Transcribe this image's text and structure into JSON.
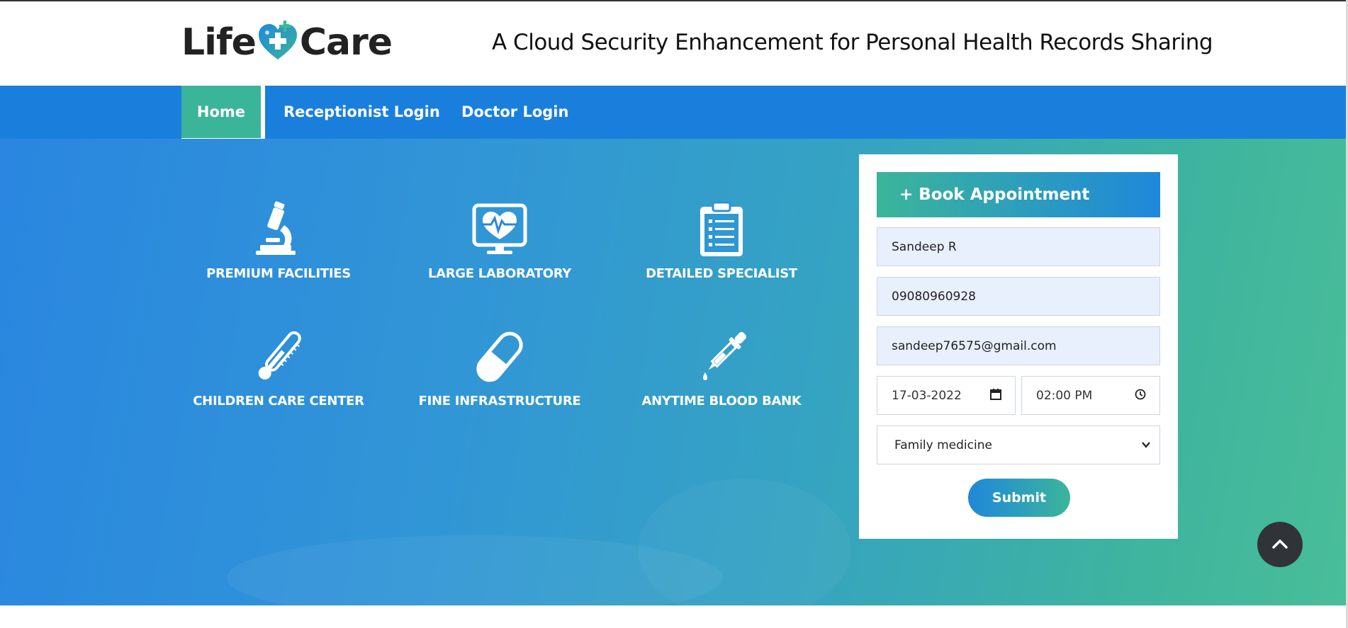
{
  "header": {
    "logo_part1": "Life",
    "logo_part2": "Care",
    "tagline": "A Cloud Security Enhancement for Personal Health Records Sharing"
  },
  "nav": {
    "items": [
      {
        "label": "Home",
        "active": true
      },
      {
        "label": "Receptionist Login"
      },
      {
        "label": "Doctor Login"
      }
    ]
  },
  "features": [
    {
      "label": "PREMIUM FACILITIES",
      "icon": "microscope-icon"
    },
    {
      "label": "LARGE LABORATORY",
      "icon": "heart-monitor-icon"
    },
    {
      "label": "DETAILED SPECIALIST",
      "icon": "clipboard-icon"
    },
    {
      "label": "CHILDREN CARE CENTER",
      "icon": "thermometer-icon"
    },
    {
      "label": "FINE INFRASTRUCTURE",
      "icon": "pill-icon"
    },
    {
      "label": "ANYTIME BLOOD BANK",
      "icon": "dropper-icon"
    }
  ],
  "form": {
    "title": "+ Book Appointment",
    "name": "Sandeep R",
    "phone": "09080960928",
    "email": "sandeep76575@gmail.com",
    "date": "17-03-2022",
    "time": "02:00 PM",
    "department": "Family medicine",
    "submit_label": "Submit"
  },
  "colors": {
    "nav_bg": "#1a7fdc",
    "accent_green": "#3bb59a",
    "totop_bg": "#303438"
  }
}
